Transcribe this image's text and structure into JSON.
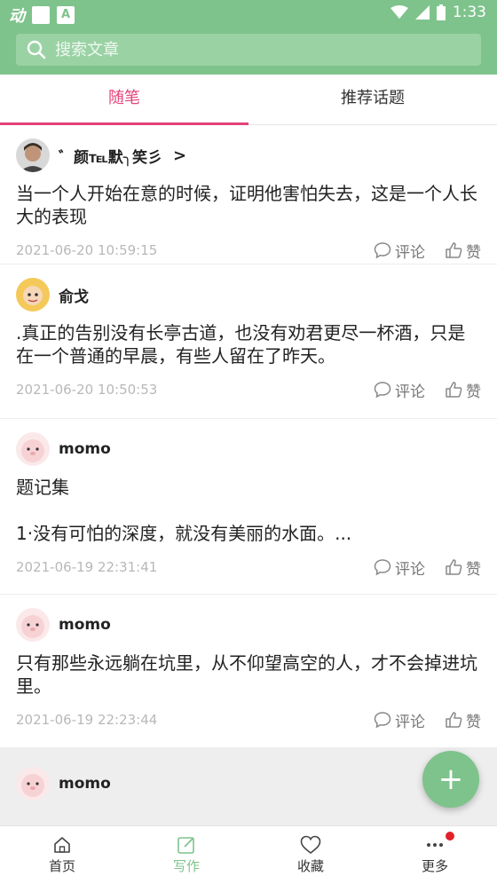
{
  "status_bar": {
    "time": "1:33",
    "anim_glyph": "动",
    "a_glyph": "A"
  },
  "search": {
    "placeholder": "搜索文章"
  },
  "tabs": [
    {
      "label": "随笔"
    },
    {
      "label": "推荐话题"
    }
  ],
  "posts": [
    {
      "author": "゛颜℡默╮笑彡",
      "chevron": ">",
      "content": "当一个人开始在意的时候，证明他害怕失去，这是一个人长大的表现",
      "time": "2021-06-20 10:59:15",
      "comment_label": "评论",
      "like_label": "赞"
    },
    {
      "author": "俞戈",
      "content": ".真正的告别没有长亭古道，也没有劝君更尽一杯酒，只是在一个普通的早晨，有些人留在了昨天。",
      "time": "2021-06-20 10:50:53",
      "comment_label": "评论",
      "like_label": "赞"
    },
    {
      "author": "momo",
      "content": "题记集\n\n1·没有可怕的深度，就没有美丽的水面。...",
      "time": "2021-06-19 22:31:41",
      "comment_label": "评论",
      "like_label": "赞"
    },
    {
      "author": "momo",
      "content": "只有那些永远躺在坑里，从不仰望高空的人，才不会掉进坑里。",
      "time": "2021-06-19 22:23:44",
      "comment_label": "评论",
      "like_label": "赞"
    },
    {
      "author": "momo"
    }
  ],
  "fab": {
    "icon": "plus-icon",
    "glyph": "+"
  },
  "bottom_nav": [
    {
      "label": "首页",
      "icon": "home-icon"
    },
    {
      "label": "写作",
      "icon": "edit-icon"
    },
    {
      "label": "收藏",
      "icon": "heart-icon"
    },
    {
      "label": "更多",
      "icon": "more-icon"
    }
  ],
  "colors": {
    "primary": "#7ec38c",
    "accent": "#e4427a",
    "badge": "#e0202a"
  }
}
